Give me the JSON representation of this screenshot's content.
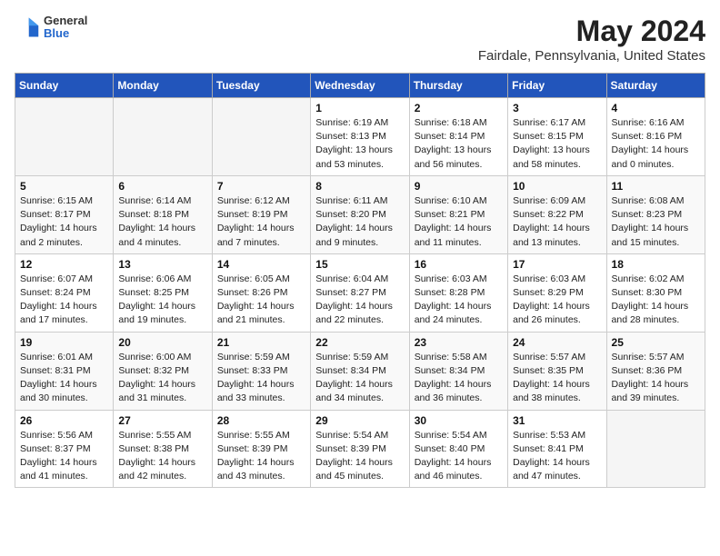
{
  "header": {
    "logo_general": "General",
    "logo_blue": "Blue",
    "title": "May 2024",
    "subtitle": "Fairdale, Pennsylvania, United States"
  },
  "columns": [
    "Sunday",
    "Monday",
    "Tuesday",
    "Wednesday",
    "Thursday",
    "Friday",
    "Saturday"
  ],
  "weeks": [
    [
      {
        "day": "",
        "sunrise": "",
        "sunset": "",
        "daylight": "",
        "empty": true
      },
      {
        "day": "",
        "sunrise": "",
        "sunset": "",
        "daylight": "",
        "empty": true
      },
      {
        "day": "",
        "sunrise": "",
        "sunset": "",
        "daylight": "",
        "empty": true
      },
      {
        "day": "1",
        "sunrise": "Sunrise: 6:19 AM",
        "sunset": "Sunset: 8:13 PM",
        "daylight": "Daylight: 13 hours and 53 minutes."
      },
      {
        "day": "2",
        "sunrise": "Sunrise: 6:18 AM",
        "sunset": "Sunset: 8:14 PM",
        "daylight": "Daylight: 13 hours and 56 minutes."
      },
      {
        "day": "3",
        "sunrise": "Sunrise: 6:17 AM",
        "sunset": "Sunset: 8:15 PM",
        "daylight": "Daylight: 13 hours and 58 minutes."
      },
      {
        "day": "4",
        "sunrise": "Sunrise: 6:16 AM",
        "sunset": "Sunset: 8:16 PM",
        "daylight": "Daylight: 14 hours and 0 minutes."
      }
    ],
    [
      {
        "day": "5",
        "sunrise": "Sunrise: 6:15 AM",
        "sunset": "Sunset: 8:17 PM",
        "daylight": "Daylight: 14 hours and 2 minutes."
      },
      {
        "day": "6",
        "sunrise": "Sunrise: 6:14 AM",
        "sunset": "Sunset: 8:18 PM",
        "daylight": "Daylight: 14 hours and 4 minutes."
      },
      {
        "day": "7",
        "sunrise": "Sunrise: 6:12 AM",
        "sunset": "Sunset: 8:19 PM",
        "daylight": "Daylight: 14 hours and 7 minutes."
      },
      {
        "day": "8",
        "sunrise": "Sunrise: 6:11 AM",
        "sunset": "Sunset: 8:20 PM",
        "daylight": "Daylight: 14 hours and 9 minutes."
      },
      {
        "day": "9",
        "sunrise": "Sunrise: 6:10 AM",
        "sunset": "Sunset: 8:21 PM",
        "daylight": "Daylight: 14 hours and 11 minutes."
      },
      {
        "day": "10",
        "sunrise": "Sunrise: 6:09 AM",
        "sunset": "Sunset: 8:22 PM",
        "daylight": "Daylight: 14 hours and 13 minutes."
      },
      {
        "day": "11",
        "sunrise": "Sunrise: 6:08 AM",
        "sunset": "Sunset: 8:23 PM",
        "daylight": "Daylight: 14 hours and 15 minutes."
      }
    ],
    [
      {
        "day": "12",
        "sunrise": "Sunrise: 6:07 AM",
        "sunset": "Sunset: 8:24 PM",
        "daylight": "Daylight: 14 hours and 17 minutes."
      },
      {
        "day": "13",
        "sunrise": "Sunrise: 6:06 AM",
        "sunset": "Sunset: 8:25 PM",
        "daylight": "Daylight: 14 hours and 19 minutes."
      },
      {
        "day": "14",
        "sunrise": "Sunrise: 6:05 AM",
        "sunset": "Sunset: 8:26 PM",
        "daylight": "Daylight: 14 hours and 21 minutes."
      },
      {
        "day": "15",
        "sunrise": "Sunrise: 6:04 AM",
        "sunset": "Sunset: 8:27 PM",
        "daylight": "Daylight: 14 hours and 22 minutes."
      },
      {
        "day": "16",
        "sunrise": "Sunrise: 6:03 AM",
        "sunset": "Sunset: 8:28 PM",
        "daylight": "Daylight: 14 hours and 24 minutes."
      },
      {
        "day": "17",
        "sunrise": "Sunrise: 6:03 AM",
        "sunset": "Sunset: 8:29 PM",
        "daylight": "Daylight: 14 hours and 26 minutes."
      },
      {
        "day": "18",
        "sunrise": "Sunrise: 6:02 AM",
        "sunset": "Sunset: 8:30 PM",
        "daylight": "Daylight: 14 hours and 28 minutes."
      }
    ],
    [
      {
        "day": "19",
        "sunrise": "Sunrise: 6:01 AM",
        "sunset": "Sunset: 8:31 PM",
        "daylight": "Daylight: 14 hours and 30 minutes."
      },
      {
        "day": "20",
        "sunrise": "Sunrise: 6:00 AM",
        "sunset": "Sunset: 8:32 PM",
        "daylight": "Daylight: 14 hours and 31 minutes."
      },
      {
        "day": "21",
        "sunrise": "Sunrise: 5:59 AM",
        "sunset": "Sunset: 8:33 PM",
        "daylight": "Daylight: 14 hours and 33 minutes."
      },
      {
        "day": "22",
        "sunrise": "Sunrise: 5:59 AM",
        "sunset": "Sunset: 8:34 PM",
        "daylight": "Daylight: 14 hours and 34 minutes."
      },
      {
        "day": "23",
        "sunrise": "Sunrise: 5:58 AM",
        "sunset": "Sunset: 8:34 PM",
        "daylight": "Daylight: 14 hours and 36 minutes."
      },
      {
        "day": "24",
        "sunrise": "Sunrise: 5:57 AM",
        "sunset": "Sunset: 8:35 PM",
        "daylight": "Daylight: 14 hours and 38 minutes."
      },
      {
        "day": "25",
        "sunrise": "Sunrise: 5:57 AM",
        "sunset": "Sunset: 8:36 PM",
        "daylight": "Daylight: 14 hours and 39 minutes."
      }
    ],
    [
      {
        "day": "26",
        "sunrise": "Sunrise: 5:56 AM",
        "sunset": "Sunset: 8:37 PM",
        "daylight": "Daylight: 14 hours and 41 minutes."
      },
      {
        "day": "27",
        "sunrise": "Sunrise: 5:55 AM",
        "sunset": "Sunset: 8:38 PM",
        "daylight": "Daylight: 14 hours and 42 minutes."
      },
      {
        "day": "28",
        "sunrise": "Sunrise: 5:55 AM",
        "sunset": "Sunset: 8:39 PM",
        "daylight": "Daylight: 14 hours and 43 minutes."
      },
      {
        "day": "29",
        "sunrise": "Sunrise: 5:54 AM",
        "sunset": "Sunset: 8:39 PM",
        "daylight": "Daylight: 14 hours and 45 minutes."
      },
      {
        "day": "30",
        "sunrise": "Sunrise: 5:54 AM",
        "sunset": "Sunset: 8:40 PM",
        "daylight": "Daylight: 14 hours and 46 minutes."
      },
      {
        "day": "31",
        "sunrise": "Sunrise: 5:53 AM",
        "sunset": "Sunset: 8:41 PM",
        "daylight": "Daylight: 14 hours and 47 minutes."
      },
      {
        "day": "",
        "sunrise": "",
        "sunset": "",
        "daylight": "",
        "empty": true
      }
    ]
  ]
}
